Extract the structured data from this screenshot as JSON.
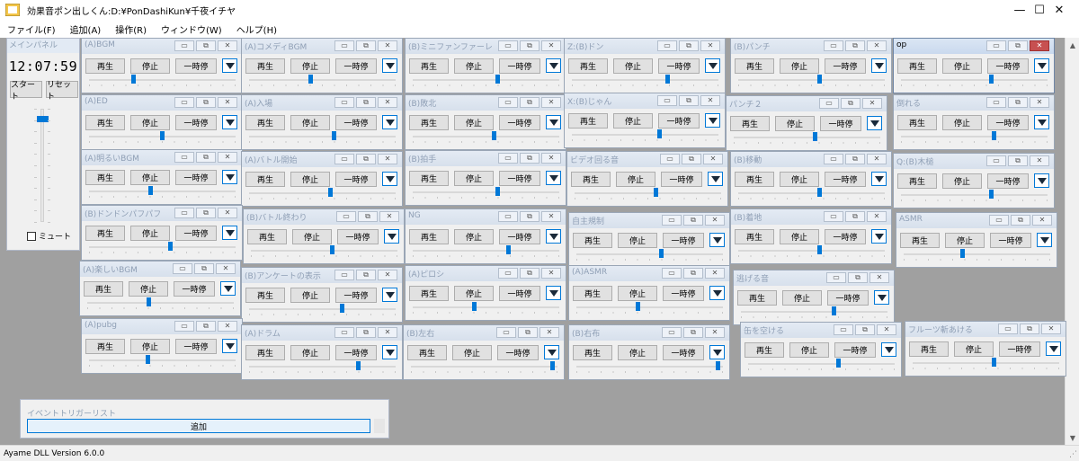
{
  "window": {
    "title": "効果音ポン出しくん:D:¥PonDashiKun¥千夜イチヤ",
    "controls": {
      "minimize": "—",
      "maximize": "☐",
      "close": "✕"
    }
  },
  "menu": [
    "ファイル(F)",
    "追加(A)",
    "操作(R)",
    "ウィンドウ(W)",
    "ヘルプ(H)"
  ],
  "main_panel": {
    "title": "メインパネル",
    "clock": "12:07:59",
    "start_label": "スタート",
    "reset_label": "リセット",
    "volume_level": 0.93,
    "mute_label": "ミュート",
    "mute_checked": false
  },
  "player_labels": {
    "play": "再生",
    "stop": "停止",
    "pause": "一時停"
  },
  "players": [
    {
      "title": "(A)BGM",
      "position": 0.3
    },
    {
      "title": "(A)コメディBGM",
      "position": 0.42
    },
    {
      "title": "(B)ミニファンファーレ",
      "position": 0.58
    },
    {
      "title": "Z:(B)ドン",
      "position": 0.66
    },
    {
      "title": "(B)パンチ",
      "position": 0.56
    },
    {
      "title": "op",
      "position": 0.62,
      "active": true
    },
    {
      "title": "(A)ED",
      "position": 0.5
    },
    {
      "title": "(A)入場",
      "position": 0.58
    },
    {
      "title": "(B)敗北",
      "position": 0.56
    },
    {
      "title": "X:(B)じゃん",
      "position": 0.6
    },
    {
      "title": "パンチ２",
      "position": 0.56
    },
    {
      "title": "倒れる",
      "position": 0.64
    },
    {
      "title": "(A)明るいBGM",
      "position": 0.42
    },
    {
      "title": "(A)バトル開始",
      "position": 0.56
    },
    {
      "title": "(B)拍手",
      "position": 0.58
    },
    {
      "title": "ビデオ回る音",
      "position": 0.56
    },
    {
      "title": "(B)移動",
      "position": 0.56
    },
    {
      "title": "Q:(B)木槌",
      "position": 0.62
    },
    {
      "title": "(B)ドンドンパフパフ",
      "position": 0.56
    },
    {
      "title": "(B)バトル終わり",
      "position": 0.56
    },
    {
      "title": "NG",
      "position": 0.66
    },
    {
      "title": "自主規制",
      "position": 0.58
    },
    {
      "title": "(B)着地",
      "position": 0.56
    },
    {
      "title": "ASMR",
      "position": 0.4
    },
    {
      "title": "(A)楽しいBGM",
      "position": 0.42
    },
    {
      "title": "(B)アンケートの表示",
      "position": 0.64
    },
    {
      "title": "(A)ピロシ",
      "position": 0.42
    },
    {
      "title": "(A)ASMR",
      "position": 0.42
    },
    {
      "title": "逃げる音",
      "position": 0.64
    },
    {
      "title": "(A)pubg",
      "position": 0.4
    },
    {
      "title": "(A)ドラム",
      "position": 0.75
    },
    {
      "title": "(B)左右",
      "position": 0.98
    },
    {
      "title": "(B)右布",
      "position": 0.98
    },
    {
      "title": "缶を空ける",
      "position": 0.62
    },
    {
      "title": "フルーツ斬あける",
      "position": 0.56
    }
  ],
  "event_panel": {
    "title": "イベントトリガーリスト",
    "add_label": "追加"
  },
  "status": "Ayame DLL Version 6.0.0",
  "colors": {
    "accent": "#0078d7",
    "workspace": "#a0a0a0",
    "panel_bg": "#f0f0f0"
  }
}
